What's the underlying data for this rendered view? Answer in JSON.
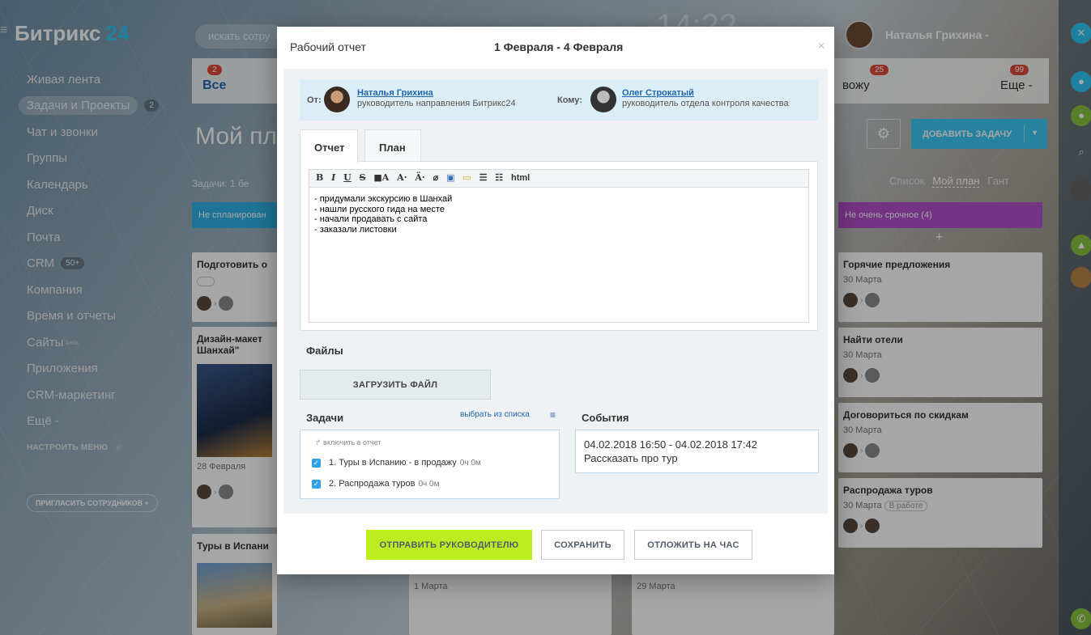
{
  "app": {
    "logo_main": "Битрикс",
    "logo_num": "24",
    "search_placeholder": "искать сотру"
  },
  "sidebar": {
    "items": [
      {
        "label": "Живая лента"
      },
      {
        "label": "Задачи и Проекты",
        "counter": "2"
      },
      {
        "label": "Чат и звонки"
      },
      {
        "label": "Группы"
      },
      {
        "label": "Календарь"
      },
      {
        "label": "Диск"
      },
      {
        "label": "Почта"
      },
      {
        "label": "CRM",
        "counter": "50+"
      },
      {
        "label": "Компания"
      },
      {
        "label": "Время и отчеты"
      },
      {
        "label": "Сайты",
        "tag": "beta"
      },
      {
        "label": "Приложения"
      },
      {
        "label": "CRM-маркетинг"
      },
      {
        "label": "Ещё -"
      }
    ],
    "settings_label": "НАСТРОИТЬ МЕНЮ",
    "invite_label": "ПРИГЛАСИТЬ СОТРУДНИКОВ +"
  },
  "header": {
    "user_name": "Наталья Грихина -",
    "clock": "14:22"
  },
  "tabs": {
    "all": "Все",
    "all_count": "2",
    "my": "вожу",
    "my_count": "25",
    "more": "Еще -",
    "more_count": "99"
  },
  "page": {
    "title": "Мой пла",
    "tasks_summary": "Задачи: 1 бе",
    "add_task": "ДОБАВИТЬ ЗАДАЧУ"
  },
  "views": {
    "list": "Список",
    "myplan": "Мой план",
    "gantt": "Гант"
  },
  "columns": {
    "left": "Не спланирован",
    "right": "Не очень срочное (4)"
  },
  "cards_left": [
    {
      "title": "Подготовить о"
    },
    {
      "title": "Дизайн-макет Шанхай\"",
      "date": "28 Февраля"
    },
    {
      "title": "Туры в Испани"
    }
  ],
  "cards_right": [
    {
      "title": "Горячие предложения",
      "date": "30 Марта"
    },
    {
      "title": "Найти отели",
      "date": "30 Марта"
    },
    {
      "title": "Договориться по скидкам",
      "date": "30 Марта"
    },
    {
      "title": "Распродажа туров",
      "date": "30 Марта",
      "status": "В работе"
    }
  ],
  "cards_bottom": [
    {
      "date": "1 Марта"
    },
    {
      "date": "29 Марта"
    }
  ],
  "modal": {
    "title": "Рабочий отчет",
    "dates": "1 Февраля - 4 Февраля",
    "from_label": "От:",
    "from_name": "Наталья Грихина",
    "from_role": "руководитель направления Битрикс24",
    "to_label": "Кому:",
    "to_name": "Олег Строкатый",
    "to_role": "руководитель отдела контроля качества",
    "tab_report": "Отчет",
    "tab_plan": "План",
    "toolbar_html": "html",
    "report_lines": [
      "- придумали экскурсию в Шанхай",
      "- нашли русского гида на месте",
      "- начали продавать с сайта",
      "- заказали листовки"
    ],
    "files_label": "Файлы",
    "upload_label": "ЗАГРУЗИТЬ ФАЙЛ",
    "tasks_label": "Задачи",
    "pick_label": "выбрать из списка",
    "include_label": "включить в отчет",
    "tasks": [
      {
        "name": "1. Туры в Испанию - в продажу",
        "time": "0ч 0м",
        "checked": true
      },
      {
        "name": "2. Распродажа туров",
        "time": "0ч 0м",
        "checked": true
      }
    ],
    "events_label": "События",
    "event_time": "04.02.2018 16:50 - 04.02.2018 17:42",
    "event_name": "Рассказать про тур",
    "btn_send": "ОТПРАВИТЬ РУКОВОДИТЕЛЮ",
    "btn_save": "СОХРАНИТЬ",
    "btn_postpone": "ОТЛОЖИТЬ НА ЧАС"
  },
  "colors": {
    "accent_green": "#bbed21",
    "accent_blue": "#3bc8f5",
    "link": "#2067b0",
    "purple": "#b34fc9"
  }
}
